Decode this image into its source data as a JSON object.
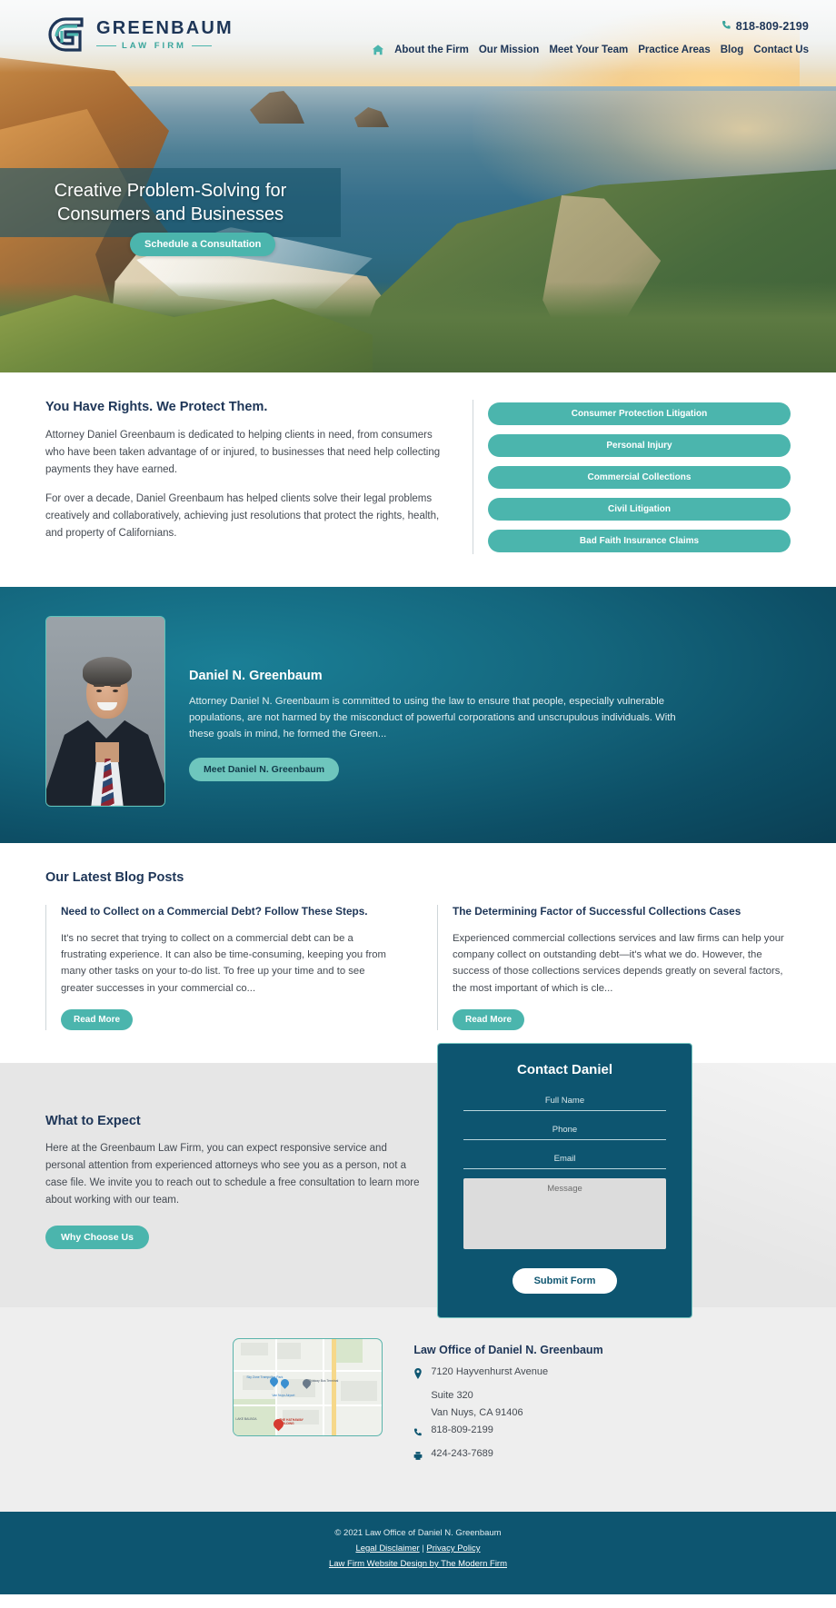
{
  "brand": {
    "name": "GREENBAUM",
    "subtitle": "LAW FIRM",
    "logo_icon": "greenbaum-g-monogram"
  },
  "header": {
    "phone": "818-809-2199",
    "phone_icon": "phone-icon",
    "home_icon": "home-icon",
    "nav": [
      {
        "label": "About the Firm"
      },
      {
        "label": "Our Mission"
      },
      {
        "label": "Meet Your Team"
      },
      {
        "label": "Practice Areas"
      },
      {
        "label": "Blog"
      },
      {
        "label": "Contact Us"
      }
    ]
  },
  "hero": {
    "headline_line1": "Creative Problem-Solving for",
    "headline_line2": "Consumers and Businesses",
    "cta_label": "Schedule a Consultation"
  },
  "intro": {
    "heading": "You Have Rights. We Protect Them.",
    "paragraph1": "Attorney Daniel Greenbaum is dedicated to helping clients in need, from consumers who have been taken advantage of or injured, to businesses that need help collecting payments they have earned.",
    "paragraph2": "For over a decade, Daniel Greenbaum has helped clients solve their legal problems creatively and collaboratively, achieving just resolutions that protect the rights, health, and property of Californians.",
    "practice_areas": [
      {
        "label": "Consumer Protection Litigation"
      },
      {
        "label": "Personal Injury"
      },
      {
        "label": "Commercial Collections"
      },
      {
        "label": "Civil Litigation"
      },
      {
        "label": "Bad Faith Insurance Claims"
      }
    ]
  },
  "attorney": {
    "name": "Daniel N. Greenbaum",
    "bio": "Attorney Daniel N. Greenbaum is committed to using the law to ensure that people, especially vulnerable populations, are not harmed by the misconduct of powerful corporations and unscrupulous individuals. With these goals in mind, he formed the Green...",
    "cta_label": "Meet Daniel N. Greenbaum",
    "photo_alt": "attorney-headshot"
  },
  "blog": {
    "heading": "Our Latest Blog Posts",
    "posts": [
      {
        "title": "Need to Collect on a Commercial Debt? Follow These Steps.",
        "excerpt": "It's no secret that trying to collect on a commercial debt can be a frustrating experience. It can also be time-consuming, keeping you from many other tasks on your to-do list. To free up your time and to see greater successes in your commercial co...",
        "cta_label": "Read More"
      },
      {
        "title": "The Determining Factor of Successful Collections Cases",
        "excerpt": "Experienced commercial collections services and law firms can help your company collect on outstanding debt—it's what we do. However, the success of those collections services depends greatly on several factors, the most important of which is cle...",
        "cta_label": "Read More"
      }
    ]
  },
  "expect": {
    "heading": "What to Expect",
    "paragraph": "Here at the Greenbaum Law Firm, you can expect responsive service and personal attention from experienced attorneys who see you as a person, not a case file. We invite you to reach out to schedule a free consultation to learn more about working with our team.",
    "cta_label": "Why Choose Us"
  },
  "contact_form": {
    "title": "Contact Daniel",
    "fields": {
      "full_name_placeholder": "Full Name",
      "full_name_value": "",
      "phone_placeholder": "Phone",
      "phone_value": "",
      "email_placeholder": "Email",
      "email_value": "",
      "message_placeholder": "Message",
      "message_value": ""
    },
    "submit_label": "Submit Form"
  },
  "location": {
    "office_name": "Law Office of Daniel N. Greenbaum",
    "address_line1": "7120 Hayvenhurst Avenue",
    "address_line2": "Suite 320",
    "address_line3": "Van Nuys, CA 91406",
    "phone": "818-809-2199",
    "fax": "424-243-7689",
    "pin_icon": "map-pin-icon",
    "phone_icon": "phone-icon",
    "fax_icon": "fax-icon",
    "map_labels": {
      "sky_zone": "Sky Zone Trampoline Park",
      "van_nuys_airport": "Van Nuys Airport",
      "flyaway": "Flyaway Bus Terminal",
      "hathaway": "THE HATHAWAY BUILDING",
      "lake_balboa": "LAKE BALBOA"
    }
  },
  "footer": {
    "copyright": "© 2021 Law Office of Daniel N. Greenbaum",
    "legal_disclaimer": "Legal Disclaimer",
    "separator": "|",
    "privacy_policy": "Privacy Policy",
    "credit": "Law Firm Website Design by The Modern Firm"
  },
  "colors": {
    "teal": "#4bb5ad",
    "navy": "#1d3557",
    "deep_teal": "#0d5570"
  }
}
